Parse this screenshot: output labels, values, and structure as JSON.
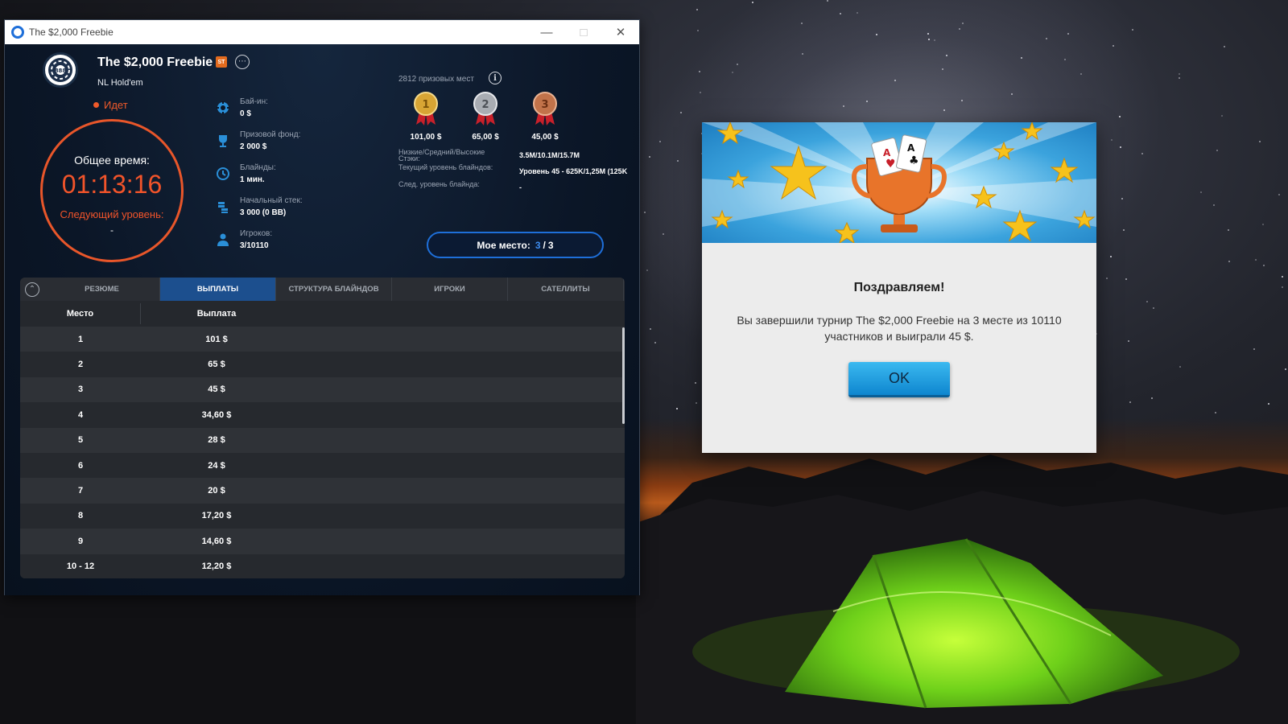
{
  "window": {
    "title": "The $2,000 Freebie",
    "controls": [
      "minimize",
      "maximize",
      "close"
    ]
  },
  "tournament": {
    "name": "The $2,000 Freebie",
    "badge": "ST",
    "game_type": "NL Hold'em",
    "status": "Идет"
  },
  "clock": {
    "label": "Общее время:",
    "time": "01:13:16",
    "next_label": "Следующий уровень:",
    "next_value": "-"
  },
  "info": [
    {
      "label": "Бай-ин:",
      "value": "0 $",
      "icon": "poker-chip-icon"
    },
    {
      "label": "Призовой фонд:",
      "value": "2 000 $",
      "icon": "trophy-icon"
    },
    {
      "label": "Блайнды:",
      "value": "1 мин.",
      "icon": "clock-icon"
    },
    {
      "label": "Начальный стек:",
      "value": "3 000 (0 BB)",
      "icon": "chip-stack-icon"
    },
    {
      "label": "Игроков:",
      "value": "3/10110",
      "icon": "user-icon"
    }
  ],
  "prizes": {
    "count_label": "2812 призовых мест",
    "top": [
      {
        "place": "1",
        "amount": "101,00 $",
        "medal": "gold"
      },
      {
        "place": "2",
        "amount": "65,00 $",
        "medal": "silver"
      },
      {
        "place": "3",
        "amount": "45,00 $",
        "medal": "bronze"
      }
    ]
  },
  "stats": [
    {
      "label": "Низкие/Средний/Высокие Стэки:",
      "value": "3.5M/10.1M/15.7M"
    },
    {
      "label": "Текущий уровень блайндов:",
      "value": "Уровень 45 - 625K/1,25M (125K"
    },
    {
      "label": "След. уровень блайнда:",
      "value": "-"
    }
  ],
  "my_place": {
    "label": "Мое место:",
    "current": "3",
    "separator": "/",
    "total": "3"
  },
  "tabs": [
    "РЕЗЮМЕ",
    "ВЫПЛАТЫ",
    "СТРУКТУРА БЛАЙНДОВ",
    "ИГРОКИ",
    "САТЕЛЛИТЫ"
  ],
  "active_tab": "ВЫПЛАТЫ",
  "payouts": {
    "headers": [
      "Место",
      "Выплата"
    ],
    "rows": [
      [
        "1",
        "101 $"
      ],
      [
        "2",
        "65 $"
      ],
      [
        "3",
        "45 $"
      ],
      [
        "4",
        "34,60 $"
      ],
      [
        "5",
        "28 $"
      ],
      [
        "6",
        "24 $"
      ],
      [
        "7",
        "20 $"
      ],
      [
        "8",
        "17,20 $"
      ],
      [
        "9",
        "14,60 $"
      ],
      [
        "10 - 12",
        "12,20 $"
      ]
    ]
  },
  "dialog": {
    "title": "Поздравляем!",
    "message": "Вы завершили турнир The $2,000 Freebie на 3 месте из 10110 участников и выиграли 45 $.",
    "ok_label": "OK"
  },
  "colors": {
    "accent_orange": "#f2542a",
    "accent_blue": "#1e6fd9",
    "active_tab": "#1c4f8e"
  }
}
